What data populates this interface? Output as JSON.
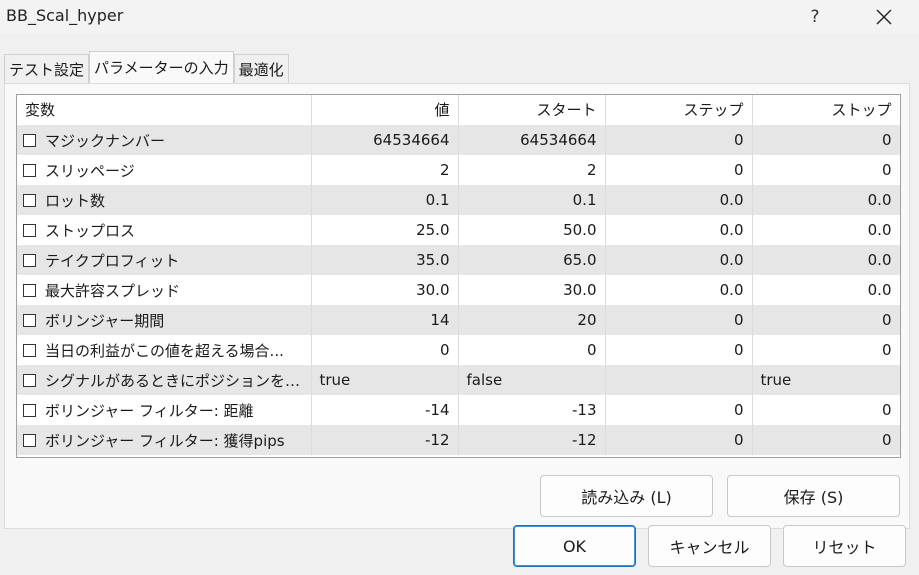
{
  "window": {
    "title": "BB_Scal_hyper",
    "help_label": "?"
  },
  "tabs": [
    {
      "label": "テスト設定"
    },
    {
      "label": "パラメーターの入力"
    },
    {
      "label": "最適化"
    }
  ],
  "table": {
    "headers": {
      "variable": "変数",
      "value": "値",
      "start": "スタート",
      "step": "ステップ",
      "stop": "ストップ"
    },
    "rows": [
      {
        "name": "マジックナンバー",
        "value": "64534664",
        "start": "64534664",
        "step": "0",
        "stop": "0"
      },
      {
        "name": "スリッページ",
        "value": "2",
        "start": "2",
        "step": "0",
        "stop": "0"
      },
      {
        "name": "ロット数",
        "value": "0.1",
        "start": "0.1",
        "step": "0.0",
        "stop": "0.0"
      },
      {
        "name": "ストップロス",
        "value": "25.0",
        "start": "50.0",
        "step": "0.0",
        "stop": "0.0"
      },
      {
        "name": "テイクプロフィット",
        "value": "35.0",
        "start": "65.0",
        "step": "0.0",
        "stop": "0.0"
      },
      {
        "name": "最大許容スプレッド",
        "value": "30.0",
        "start": "30.0",
        "step": "0.0",
        "stop": "0.0"
      },
      {
        "name": "ボリンジャー期間",
        "value": "14",
        "start": "20",
        "step": "0",
        "stop": "0"
      },
      {
        "name": "当日の利益がこの値を超える場合...",
        "value": "0",
        "start": "0",
        "step": "0",
        "stop": "0"
      },
      {
        "name": "シグナルがあるときにポジションをク・..",
        "value": "true",
        "start": "false",
        "step": "",
        "stop": "true"
      },
      {
        "name": "ボリンジャー フィルター: 距離",
        "value": "-14",
        "start": "-13",
        "step": "0",
        "stop": "0"
      },
      {
        "name": "ボリンジャー フィルター: 獲得pips",
        "value": "-12",
        "start": "-12",
        "step": "0",
        "stop": "0"
      }
    ]
  },
  "buttons": {
    "load": "読み込み (L)",
    "save": "保存 (S)",
    "ok": "OK",
    "cancel": "キャンセル",
    "reset": "リセット"
  },
  "icons": {
    "close": "close-icon",
    "checkbox": "checkbox-unchecked"
  },
  "colors": {
    "row_alt": "#e6e6e6",
    "default_button_border": "#1d6fb8"
  }
}
